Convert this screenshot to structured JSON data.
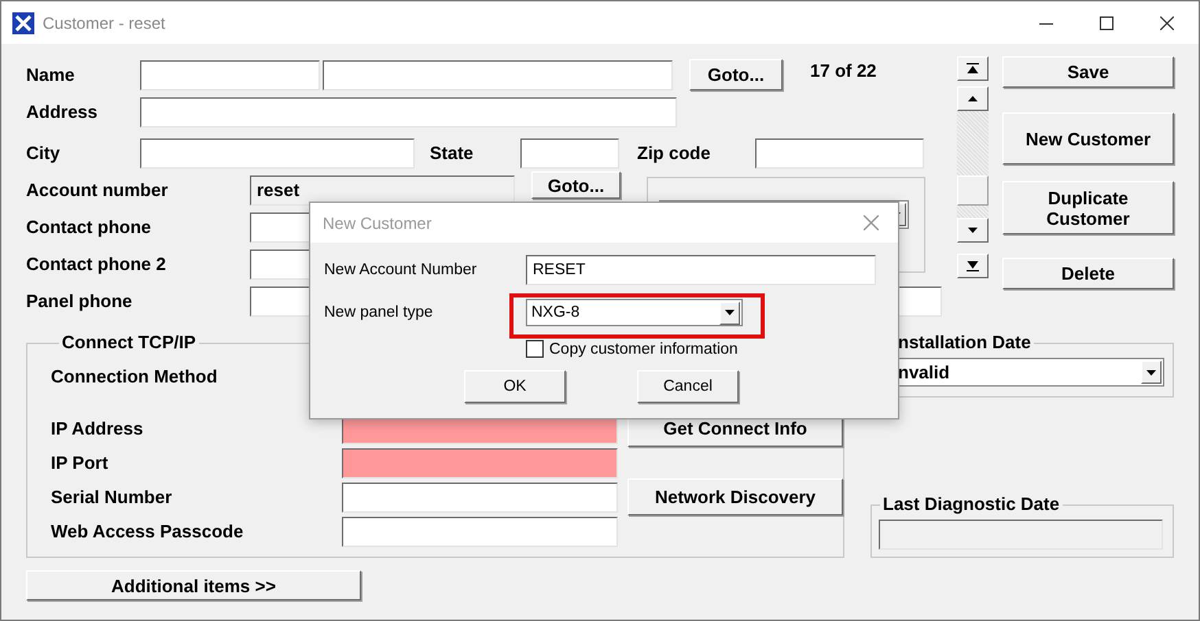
{
  "window": {
    "title": "Customer - reset"
  },
  "customer": {
    "name": {
      "label": "Name",
      "button": "Goto..."
    },
    "record_position": "17 of 22",
    "address": {
      "label": "Address"
    },
    "city": {
      "label": "City"
    },
    "state": {
      "label": "State"
    },
    "zip": {
      "label": "Zip code"
    },
    "account_number": {
      "label": "Account number",
      "value": "reset",
      "button": "Goto..."
    },
    "contact_phone": {
      "label": "Contact phone"
    },
    "contact_phone_2": {
      "label": "Contact phone 2"
    },
    "panel_phone": {
      "label": "Panel phone"
    }
  },
  "actions": [
    "Save",
    "New Customer",
    "Duplicate Customer",
    "Delete"
  ],
  "connect": {
    "title": "Connect TCP/IP",
    "connection_method": {
      "label": "Connection Method"
    },
    "fields": [
      {
        "label": "IP Address",
        "invalid": true
      },
      {
        "label": "IP Port",
        "invalid": true
      },
      {
        "label": "Serial Number",
        "invalid": false
      },
      {
        "label": "Web Access Passcode",
        "invalid": false
      }
    ],
    "buttons": [
      "Get Connect Info",
      "Network Discovery"
    ]
  },
  "installation_date": {
    "title": "nstallation Date",
    "value": "nvalid"
  },
  "last_diagnostic_date": {
    "title": "Last Diagnostic Date"
  },
  "additional_button": "Additional items  >>",
  "dialog": {
    "title": "New Customer",
    "account_label": "New Account Number",
    "account_value": "RESET",
    "panel_label": "New panel type",
    "panel_value": "NXG-8",
    "highlighted": true,
    "copy": {
      "label": "Copy customer information",
      "checked": false
    },
    "buttons": [
      "OK",
      "Cancel"
    ]
  }
}
